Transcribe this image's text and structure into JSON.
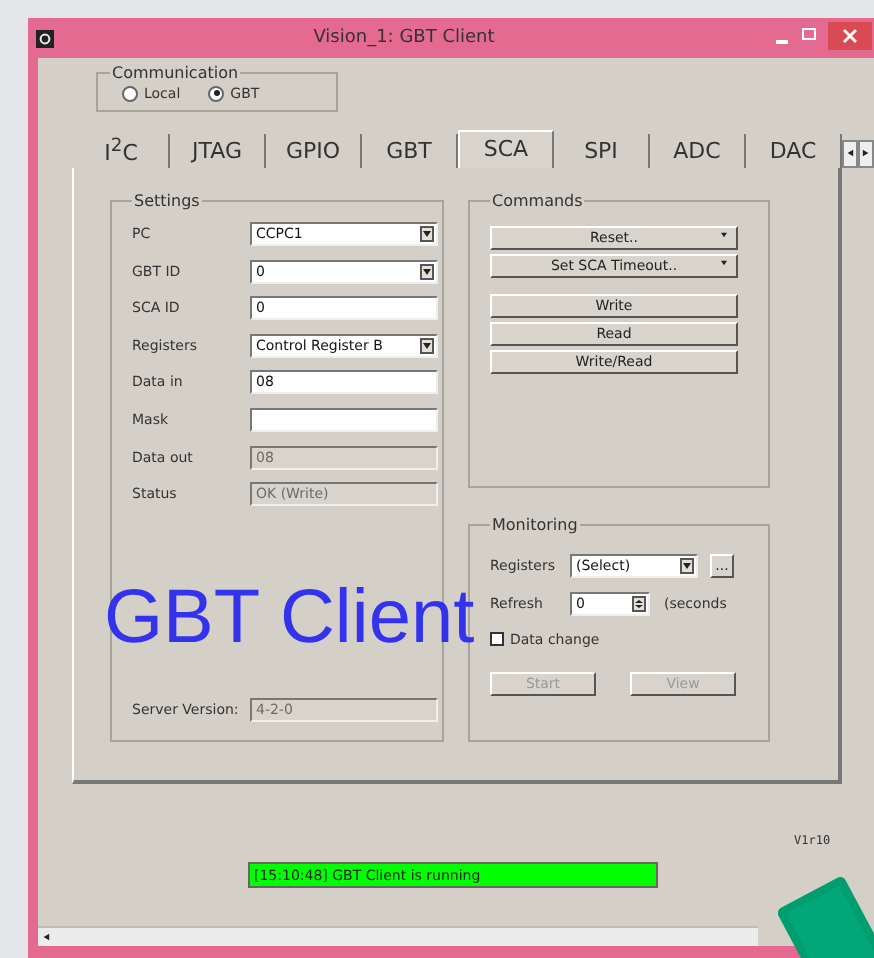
{
  "window": {
    "title": "Vision_1: GBT Client"
  },
  "communication": {
    "label": "Communication",
    "options": [
      {
        "label": "Local",
        "selected": false
      },
      {
        "label": "GBT",
        "selected": true
      }
    ]
  },
  "tabs": [
    {
      "label": "I$^{2}$C",
      "selected": false
    },
    {
      "label": "JTAG",
      "selected": false
    },
    {
      "label": "GPIO",
      "selected": false
    },
    {
      "label": "GBT",
      "selected": false
    },
    {
      "label": "SCA",
      "selected": true
    },
    {
      "label": "SPI",
      "selected": false
    },
    {
      "label": "ADC",
      "selected": false
    },
    {
      "label": "DAC",
      "selected": false
    }
  ],
  "settings": {
    "title": "Settings",
    "fields": [
      {
        "label": "PC",
        "kind": "combo",
        "value": "CCPC1"
      },
      {
        "label": "GBT ID",
        "kind": "combo",
        "value": "0"
      },
      {
        "label": "SCA ID",
        "kind": "text",
        "value": "0"
      },
      {
        "label": "Registers",
        "kind": "combo",
        "value": "Control Register B"
      },
      {
        "label": "Data in",
        "kind": "text",
        "value": "08"
      },
      {
        "label": "Mask",
        "kind": "text"
      },
      {
        "label": "Data out",
        "kind": "readonly",
        "value": "08"
      },
      {
        "label": "Status",
        "kind": "readonly",
        "value": "OK (Write)"
      }
    ],
    "server_version": {
      "label": "Server Version:",
      "value": "4-2-0"
    }
  },
  "commands": {
    "title": "Commands",
    "buttons": [
      {
        "label": "Reset..",
        "kind": "menu"
      },
      {
        "label": "Set SCA Timeout..",
        "kind": "menu"
      },
      {
        "label": "Write",
        "kind": "plain"
      },
      {
        "label": "Read",
        "kind": "plain"
      },
      {
        "label": "Write/Read",
        "kind": "plain"
      }
    ]
  },
  "monitoring": {
    "title": "Monitoring",
    "registers": {
      "label": "Registers",
      "value": "(Select)",
      "more": "..."
    },
    "refresh": {
      "label": "Refresh",
      "value": "0",
      "unit": "(seconds"
    },
    "data_change": {
      "label": "Data change",
      "checked": false
    },
    "buttons": [
      {
        "label": "Start",
        "disabled": true
      },
      {
        "label": "View",
        "disabled": true
      }
    ]
  },
  "version": "V1r10",
  "status": "[15:10:48] GBT Client is running",
  "overlay_title": "GBT Client"
}
